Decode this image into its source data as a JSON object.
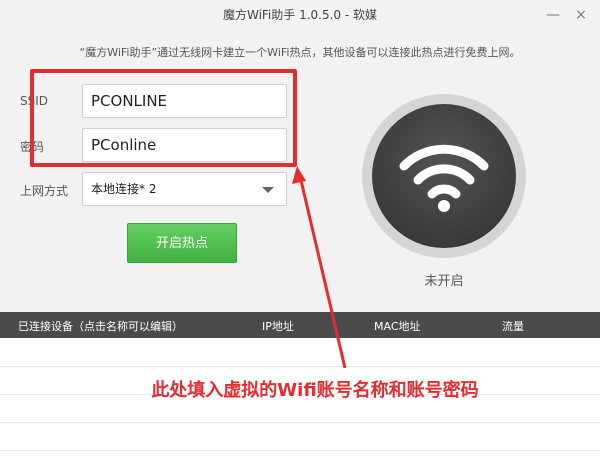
{
  "window": {
    "title": "魔方WiFi助手 1.0.5.0 - 软媒",
    "minimize_icon": "—",
    "close_icon": "×"
  },
  "notice": "“魔方WiFi助手”通过无线网卡建立一个WiFi热点，其他设备可以连接此热点进行免费上网。",
  "form": {
    "ssid_label": "SSID",
    "ssid_value": "PCONLINE",
    "password_label": "密码",
    "password_value": "PConline",
    "connection_label": "上网方式",
    "connection_value": "本地连接* 2",
    "start_button": "开启热点"
  },
  "hotspot": {
    "status": "未开启",
    "icon": "wifi-icon"
  },
  "table": {
    "headers": [
      "已连接设备（点击名称可以编辑）",
      "IP地址",
      "MAC地址",
      "流量"
    ]
  },
  "annotation": {
    "text": "此处填入虚拟的Wifi账号名称和账号密码",
    "color": "#e42d2f"
  }
}
